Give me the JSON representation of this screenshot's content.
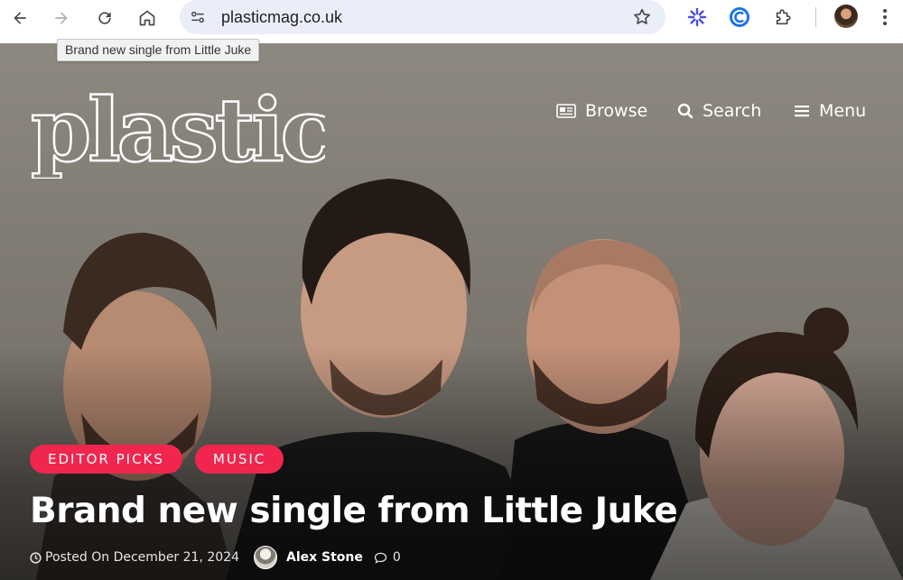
{
  "browser": {
    "url": "plasticmag.co.uk",
    "tooltip": "Brand new single from Little Juke",
    "icons": [
      "back-icon",
      "forward-icon",
      "reload-icon",
      "home-icon",
      "site-info-icon",
      "bookmark-star-icon",
      "extension-sparkle-icon",
      "extension-c-icon",
      "extensions-puzzle-icon",
      "profile-avatar",
      "more-menu-icon"
    ]
  },
  "site": {
    "logo_text": "plastic",
    "nav": {
      "browse": "Browse",
      "search": "Search",
      "menu": "Menu"
    }
  },
  "article": {
    "categories": [
      "EDITOR PICKS",
      "MUSIC"
    ],
    "title": "Brand new single from Little Juke",
    "posted": "Posted On December 21, 2024",
    "author": "Alex Stone",
    "comment_count": "0"
  },
  "colors": {
    "category_pill": "#f0264f",
    "omnibox": "#e9eef8"
  }
}
